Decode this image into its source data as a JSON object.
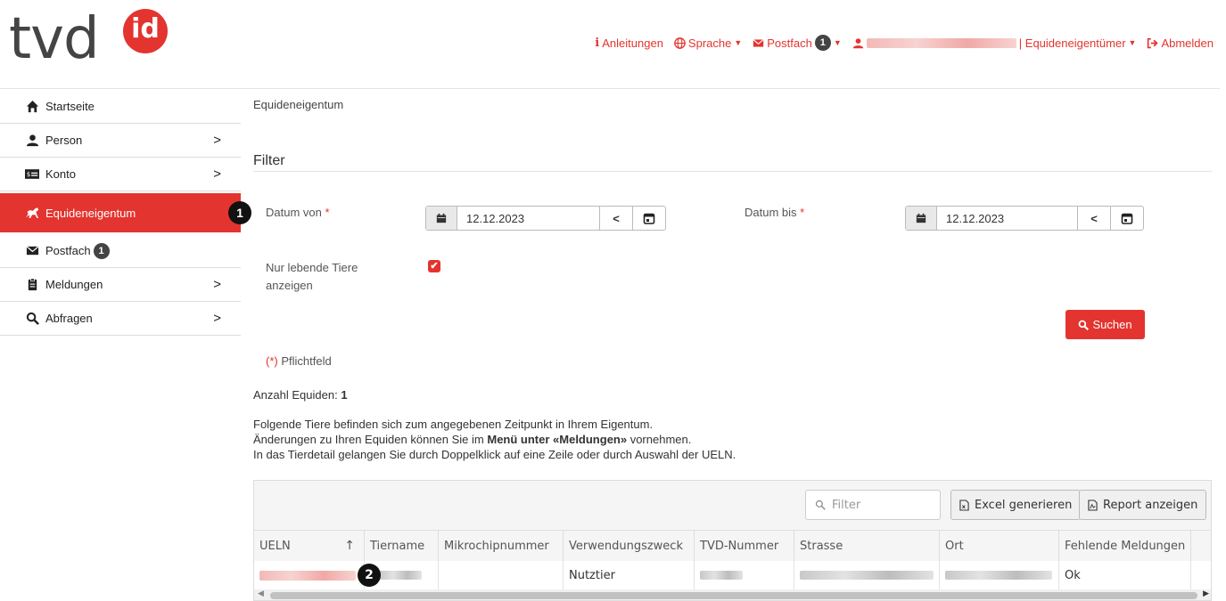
{
  "logo": {
    "text": "tvd",
    "badge": "id"
  },
  "topnav": {
    "guides": "Anleitungen",
    "language": "Sprache",
    "mailbox": "Postfach",
    "mailbox_count": "1",
    "role": "| Equideneigentümer",
    "logout": "Abmelden"
  },
  "sidebar": {
    "items": [
      {
        "label": "Startseite"
      },
      {
        "label": "Person"
      },
      {
        "label": "Konto"
      },
      {
        "label": "Equideneigentum"
      },
      {
        "label": "Postfach",
        "count": "1"
      },
      {
        "label": "Meldungen"
      },
      {
        "label": "Abfragen"
      }
    ],
    "marker": "1"
  },
  "breadcrumb": "Equideneigentum",
  "filter": {
    "heading": "Filter",
    "date_from_label": "Datum von",
    "date_from_value": "12.12.2023",
    "date_to_label": "Datum bis",
    "date_to_value": "12.12.2023",
    "required_star": "*",
    "only_living_label_1": "Nur lebende Tiere",
    "only_living_label_2": "anzeigen",
    "only_living_checked": true,
    "search_button": "Suchen",
    "required_hint_star": "(*)",
    "required_hint": "Pflichtfeld"
  },
  "count_label": "Anzahl Equiden:",
  "count_value": "1",
  "info": {
    "line1": "Folgende Tiere befinden sich zum angegebenen Zeitpunkt in Ihrem Eigentum.",
    "line2_pre": "Änderungen zu Ihren Equiden können Sie im ",
    "line2_bold": "Menü unter «Meldungen»",
    "line2_post": " vornehmen.",
    "line3": "In das Tierdetail gelangen Sie durch Doppelklick auf eine Zeile oder durch Auswahl der UELN."
  },
  "table": {
    "filter_placeholder": "Filter",
    "excel_button": "Excel generieren",
    "report_button": "Report anzeigen",
    "columns": [
      "UELN",
      "Tiername",
      "Mikrochipnummer",
      "Verwendungszweck",
      "TVD-Nummer",
      "Strasse",
      "Ort",
      "Fehlende Meldungen"
    ],
    "sort_indicator": "↑",
    "row": {
      "verwendungszweck": "Nutztier",
      "fehlende_meldungen": "Ok"
    },
    "marker": "2"
  },
  "colors": {
    "accent": "#e3342f",
    "text": "#333333"
  }
}
